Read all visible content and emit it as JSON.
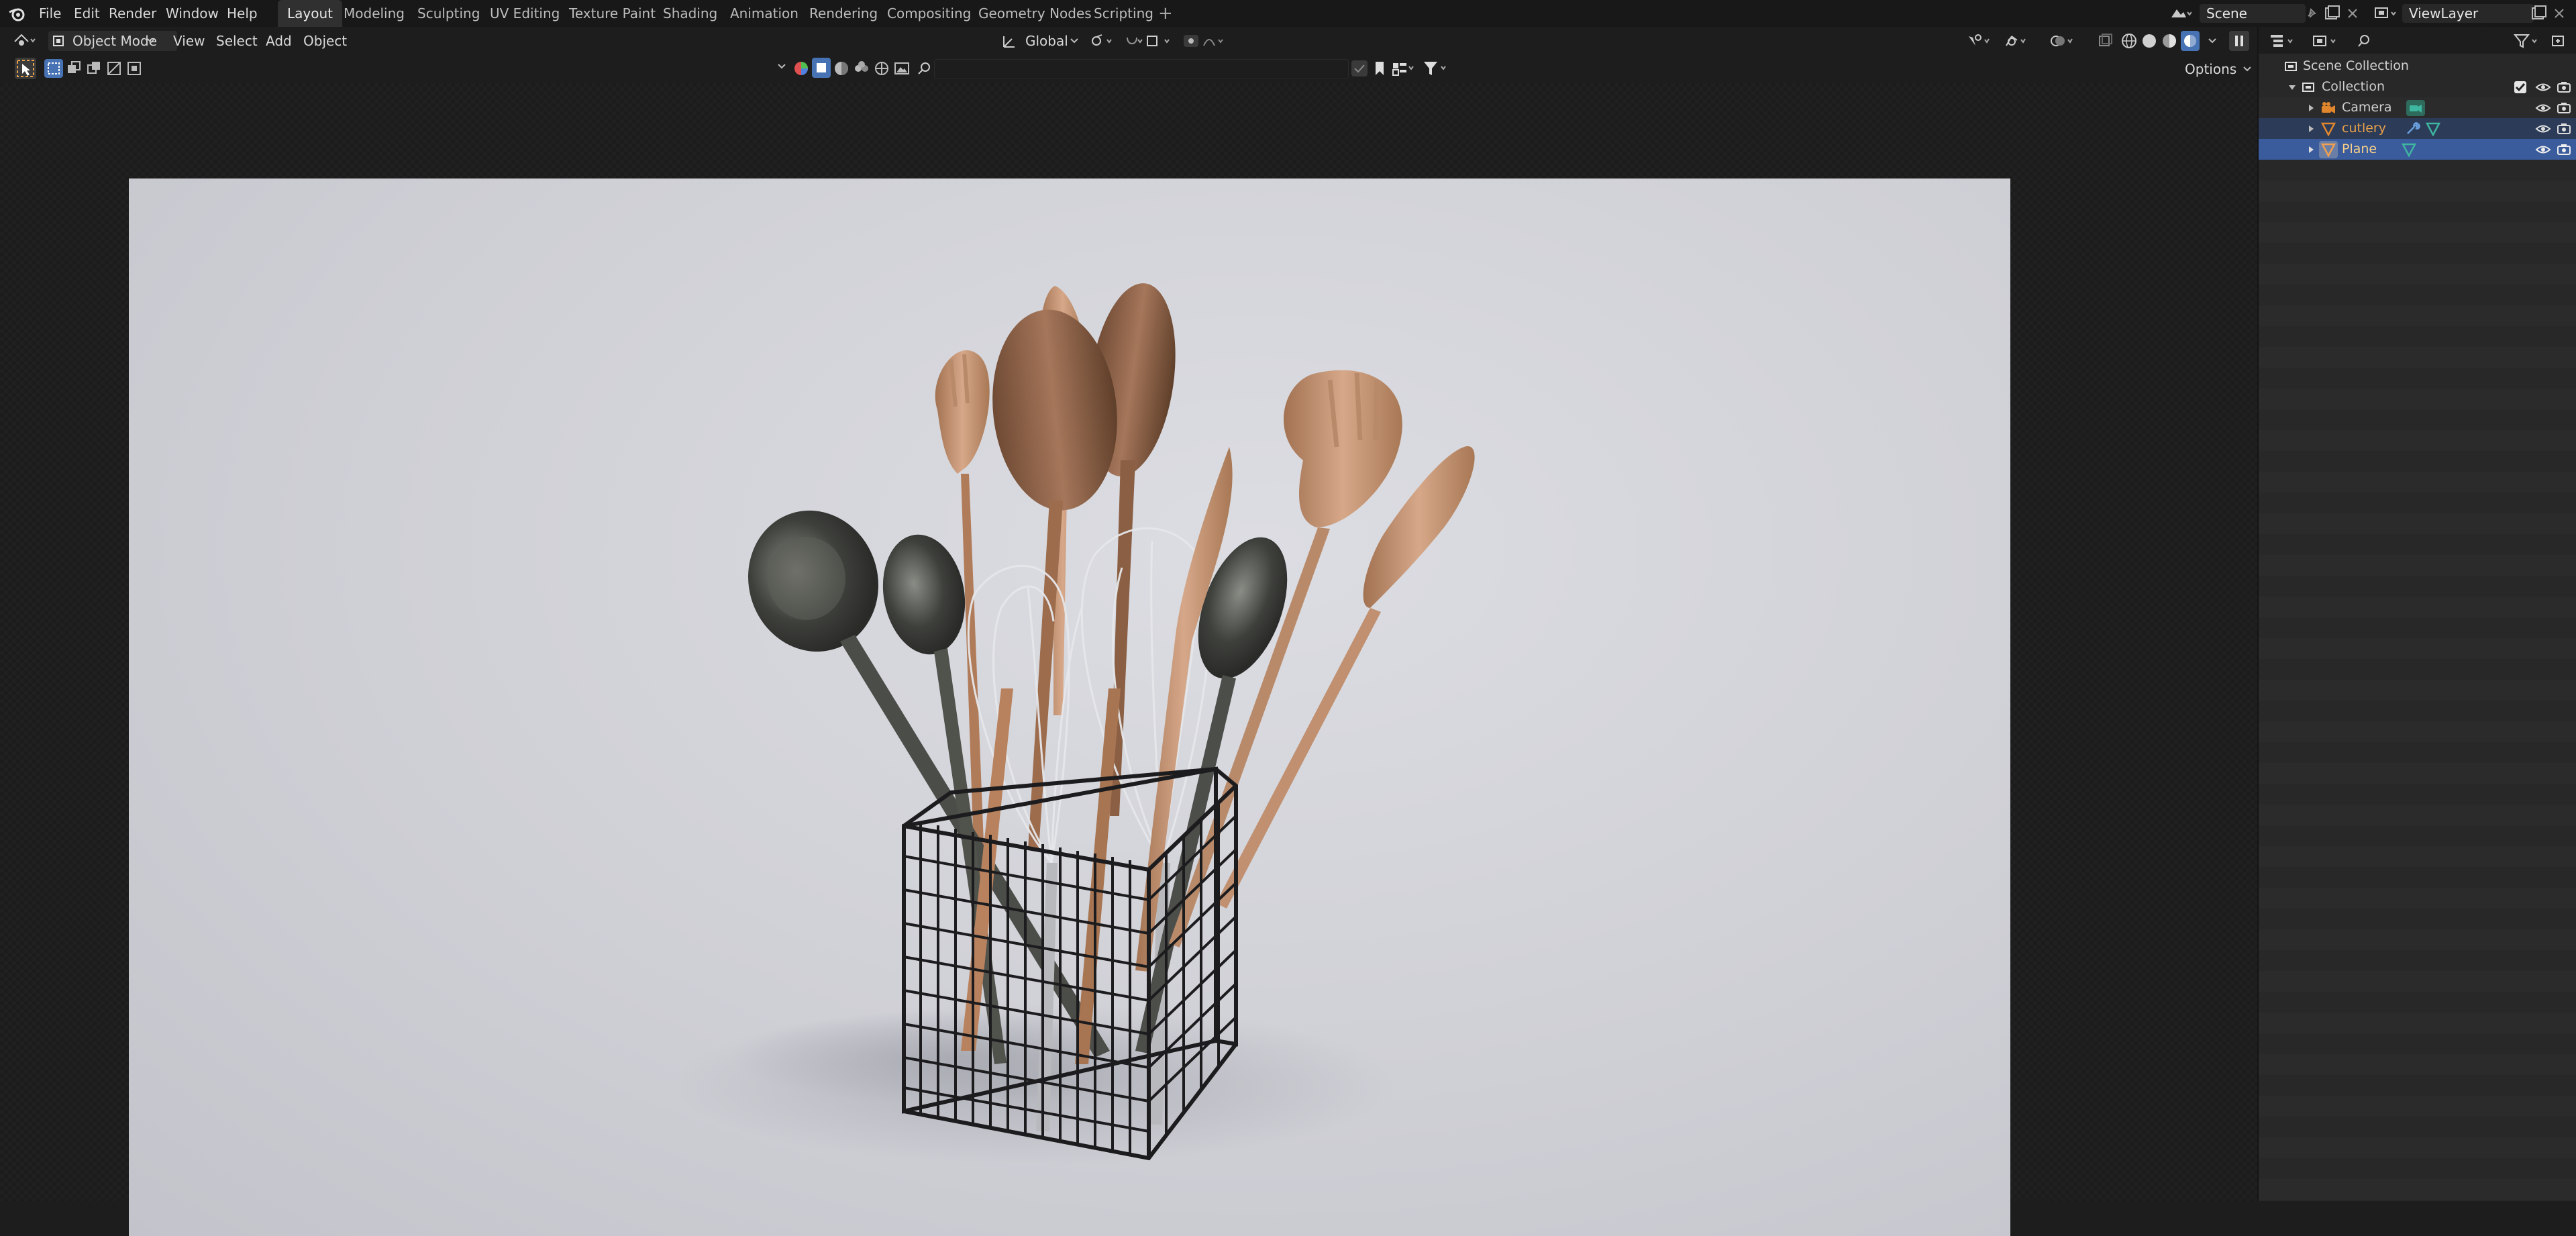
{
  "menu": {
    "file": "File",
    "edit": "Edit",
    "render": "Render",
    "window": "Window",
    "help": "Help"
  },
  "workspaces": [
    "Layout",
    "Modeling",
    "Sculpting",
    "UV Editing",
    "Texture Paint",
    "Shading",
    "Animation",
    "Rendering",
    "Compositing",
    "Geometry Nodes",
    "Scripting"
  ],
  "active_workspace": "Layout",
  "add_workspace": "+",
  "scene": {
    "name": "Scene"
  },
  "view_layer": {
    "name": "ViewLayer"
  },
  "header": {
    "mode": "Object Mode",
    "view": "View",
    "select": "Select",
    "add": "Add",
    "object": "Object",
    "orientation": "Global",
    "options": "Options"
  },
  "outliner": {
    "rows": [
      {
        "label": "Scene Collection",
        "type": "scene-collection"
      },
      {
        "label": "Collection",
        "type": "collection"
      },
      {
        "label": "Camera",
        "type": "camera"
      },
      {
        "label": "cutlery",
        "type": "mesh"
      },
      {
        "label": "Plane",
        "type": "mesh"
      }
    ]
  },
  "colors": {
    "accent": "#4772b3",
    "selected_row": "#334d80",
    "active_object_text": "#e8a14a",
    "object_orange": "#e0862d",
    "mesh_green": "#3fb6a0",
    "render_background": "#d2d3d8"
  }
}
